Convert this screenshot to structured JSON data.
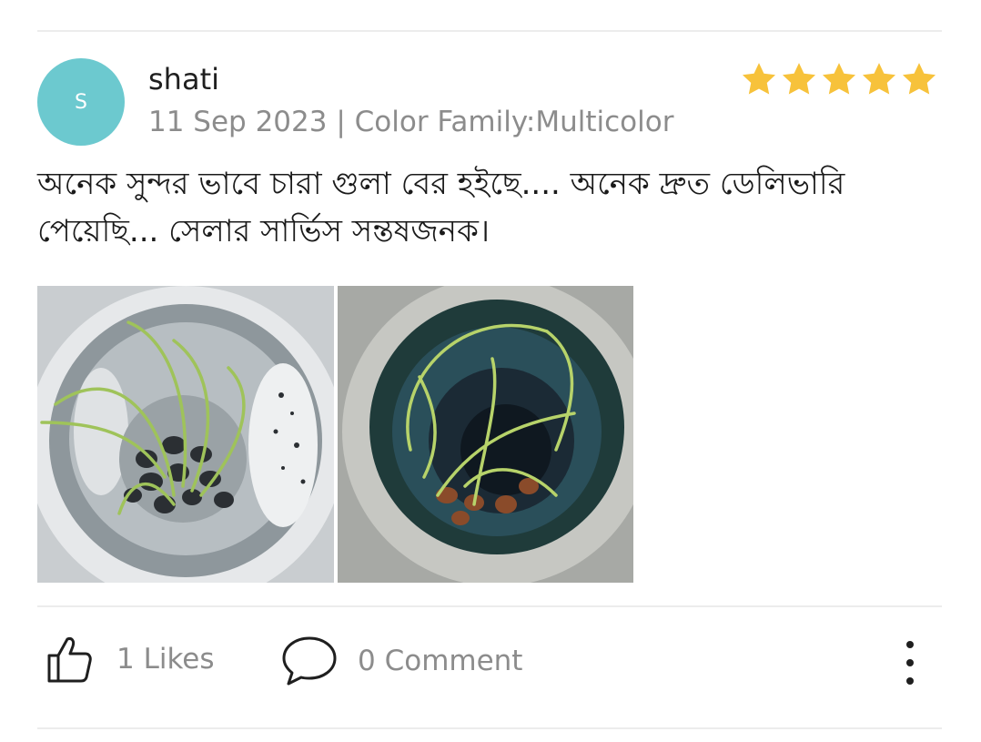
{
  "review": {
    "avatar_initial": "S",
    "username": "shati",
    "meta": "11 Sep 2023 | Color Family:Multicolor",
    "rating": 5,
    "rating_max": 5,
    "star_color": "#f7c23b",
    "avatar_color": "#6cc9cf",
    "text": "অনেক সুন্দর ভাবে চারা গুলা বের হইছে.... অনেক দ্রুত ডেলিভারি পেয়েছি... সেলার সার্ভিস সন্তষজনক।",
    "photos": [
      {
        "icon": "seedlings-in-water-cup-photo"
      },
      {
        "icon": "seedlings-in-dark-pot-photo"
      }
    ]
  },
  "actions": {
    "likes_label": "1 Likes",
    "comment_label": "0 Comment",
    "like_icon": "thumbs-up-icon",
    "comment_icon": "speech-bubble-icon",
    "more_icon": "more-vertical-icon"
  }
}
